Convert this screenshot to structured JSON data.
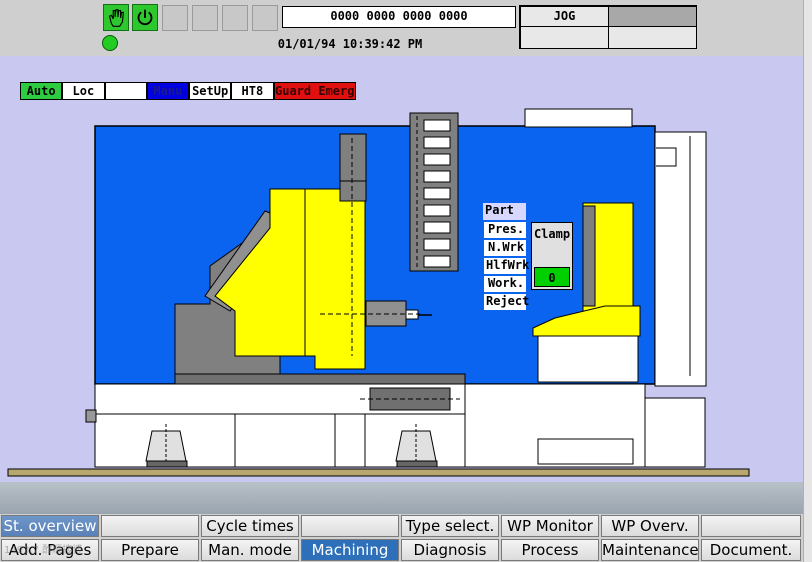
{
  "header": {
    "part_counter": "0000 0000 0000 0000",
    "datetime": "01/01/94 10:39:42 PM",
    "mode": "JOG"
  },
  "mode_bar": [
    {
      "label": "Auto",
      "bg": "#2ecc40",
      "fg": "#000000"
    },
    {
      "label": "Loc",
      "bg": "#ffffff",
      "fg": "#000000"
    },
    {
      "label": "",
      "bg": "#ffffff",
      "fg": "#000000"
    },
    {
      "label": "Manu",
      "bg": "#0000e0",
      "fg": "#1a1a8c"
    },
    {
      "label": "SetUp",
      "bg": "#ffffff",
      "fg": "#000000"
    },
    {
      "label": "HT8",
      "bg": "#ffffff",
      "fg": "#000000"
    },
    {
      "label": "Guard Emerg",
      "bg": "#e01010",
      "fg": "#3a0000"
    }
  ],
  "part_panel": {
    "title": "Part",
    "items": [
      "Pres.",
      "N.Wrk",
      "HlfWrk",
      "Work.",
      "Reject"
    ]
  },
  "clamp": {
    "label": "Clamp",
    "value": "0"
  },
  "softkeys_row1": [
    "St. overview",
    "",
    "Cycle times",
    "",
    "Type select.",
    "WP Monitor",
    "WP Overv.",
    ""
  ],
  "softkeys_row2": [
    "Add. Pages",
    "Prepare",
    "Man. mode",
    "Machining",
    "Diagnosis",
    "Process",
    "Maintenance",
    "Document."
  ],
  "watermark": "1493.7 酢顺搜博"
}
